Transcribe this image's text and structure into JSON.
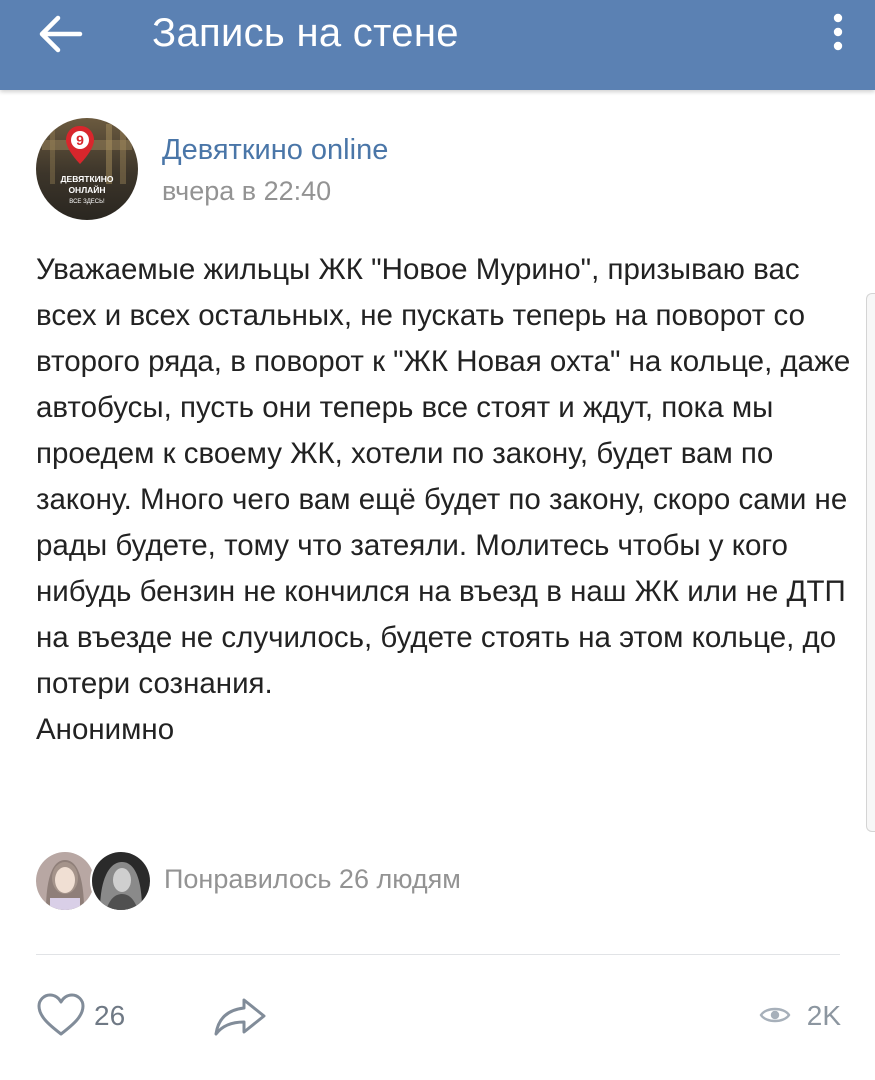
{
  "header": {
    "title": "Запись на стене",
    "back_icon": "arrow-left-icon",
    "menu_icon": "more-vertical-icon",
    "background": "#5b81b3"
  },
  "post": {
    "group_name": "Девяткино online",
    "time": "вчера в 22:40",
    "avatar": {
      "badge_number": "9",
      "line1": "ДЕВЯТКИНО",
      "line2": "ОНЛАЙН",
      "line3": "ВСЕ ЗДЕСЬ!"
    },
    "text": "Уважаемые жильцы ЖК \"Новое Мурино\", призываю вас всех и всех остальных, не пускать теперь на поворот со второго ряда, в поворот к \"ЖК Новая охта\" на кольце, даже автобусы, пусть они теперь все стоят и ждут, пока мы проедем к своему ЖК, хотели по закону, будет вам по закону. Много чего вам ещё будет по закону, скоро сами не рады будете, тому что затеяли. Молитесь чтобы у кого нибудь бензин не кончился на въезд в наш ЖК или не ДТП на въезде не случилось, будете стоять на этом кольце, до потери сознания.\nАнонимно"
  },
  "likes": {
    "text": "Понравилось 26 людям"
  },
  "actions": {
    "like_count": "26",
    "like_icon": "heart-icon",
    "share_icon": "share-arrow-icon",
    "views_icon": "eye-icon",
    "views_count": "2K"
  },
  "colors": {
    "link": "#4a76a8",
    "muted": "#939393",
    "text": "#222222"
  }
}
